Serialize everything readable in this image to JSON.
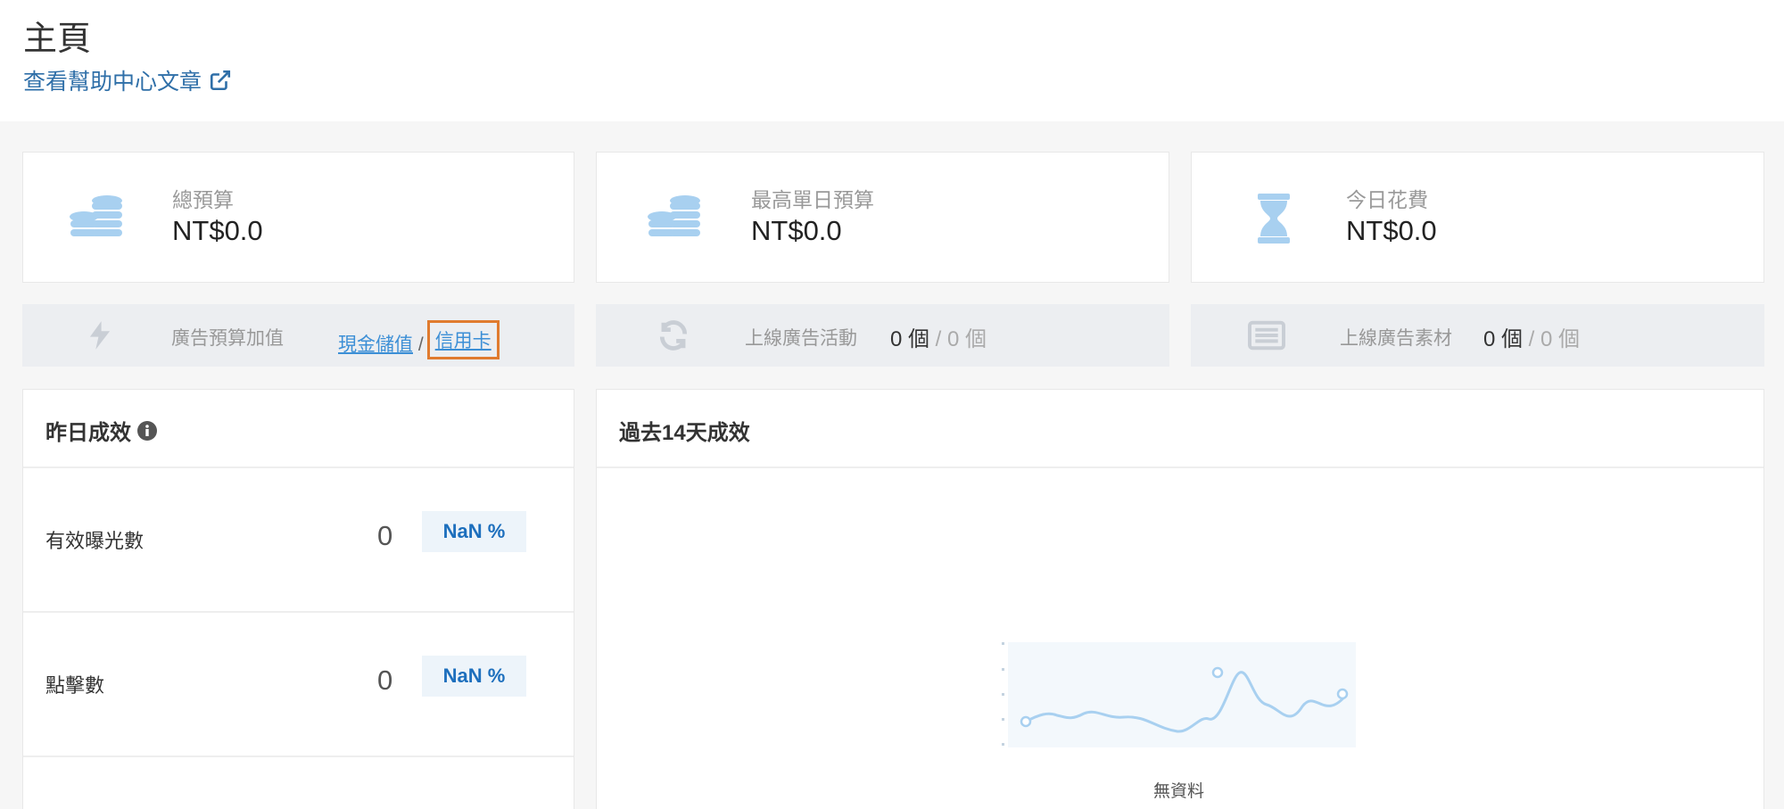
{
  "header": {
    "title": "主頁",
    "help_link": "查看幫助中心文章"
  },
  "stats": [
    {
      "label": "總預算",
      "value": "NT$0.0",
      "icon": "coins-icon"
    },
    {
      "label": "最高單日預算",
      "value": "NT$0.0",
      "icon": "coins-icon"
    },
    {
      "label": "今日花費",
      "value": "NT$0.0",
      "icon": "hourglass-icon"
    }
  ],
  "topup": {
    "label": "廣告預算加值",
    "cash": "現金儲值",
    "sep": "/",
    "credit": "信用卡"
  },
  "campaigns": {
    "label": "上線廣告活動",
    "count": "0 個",
    "total": " / 0 個"
  },
  "creatives": {
    "label": "上線廣告素材",
    "count": "0 個",
    "total": " / 0 個"
  },
  "yesterday": {
    "title": "昨日成效",
    "metrics": [
      {
        "label": "有效曝光數",
        "value": "0",
        "pct": "NaN %"
      },
      {
        "label": "點擊數",
        "value": "0",
        "pct": "NaN %"
      }
    ]
  },
  "last14": {
    "title": "過去14天成效",
    "empty": "無資料"
  },
  "colors": {
    "accent": "#3c8fd6",
    "icon": "#a8d0f0",
    "highlight": "#e07b2f"
  }
}
